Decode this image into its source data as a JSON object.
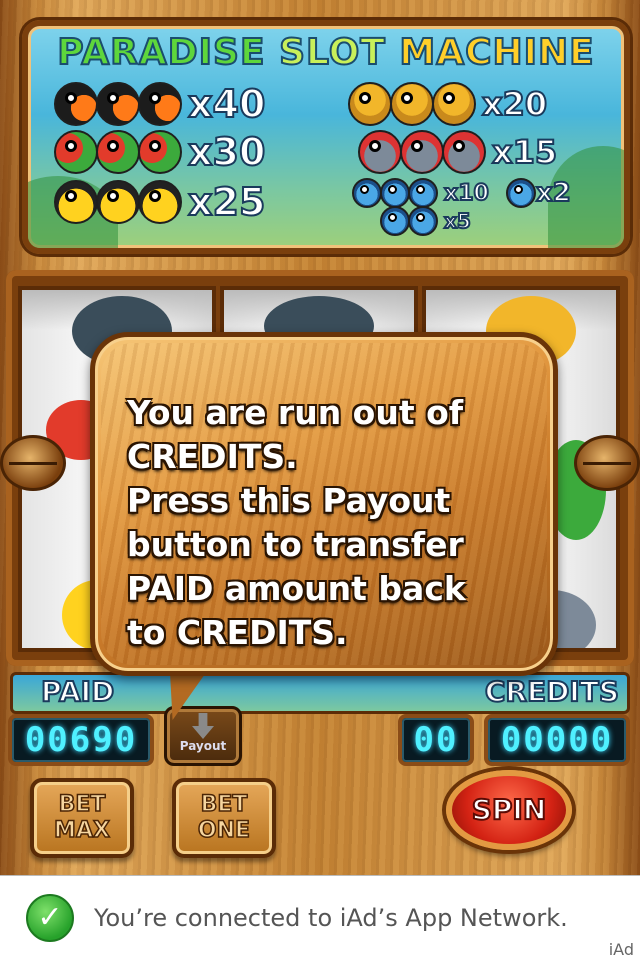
{
  "game": {
    "title_words": [
      "PARADISE",
      "SLOT",
      "MACHINE"
    ],
    "paytable": {
      "left": [
        {
          "symbol": "toucan",
          "count": 3,
          "multiplier": "x40"
        },
        {
          "symbol": "parrot",
          "count": 3,
          "multiplier": "x30"
        },
        {
          "symbol": "yellow-bird",
          "count": 3,
          "multiplier": "x25"
        }
      ],
      "right": [
        {
          "symbol": "owl",
          "count": 3,
          "multiplier": "x20"
        },
        {
          "symbol": "guinea-fowl",
          "count": 3,
          "multiplier": "x15"
        },
        {
          "symbol": "blue-bird",
          "count": 3,
          "multiplier": "x10"
        },
        {
          "symbol": "blue-bird",
          "count": 1,
          "multiplier": "x2"
        },
        {
          "symbol": "blue-bird",
          "count": 2,
          "multiplier": "x5"
        }
      ]
    }
  },
  "popup": {
    "lines": [
      "You are run out of",
      "CREDITS.",
      "Press this Payout",
      "button to transfer",
      "PAID amount back",
      "to CREDITS."
    ]
  },
  "panel": {
    "paid_label": "PAID",
    "credits_label": "CREDITS",
    "paid_value": "00690",
    "bet_value": "00",
    "credits_value": "00000",
    "payout_label": "Payout",
    "bet_max_lines": [
      "BET",
      "MAX"
    ],
    "bet_one_lines": [
      "BET",
      "ONE"
    ],
    "spin_label": "SPIN"
  },
  "ad": {
    "message": "You’re connected to iAd’s App Network.",
    "tag": "iAd"
  },
  "colors": {
    "lcd_digit": "#4ff0ff",
    "spin_red": "#d42314",
    "wood": "#c58434",
    "ad_check_green": "#27a22b"
  }
}
